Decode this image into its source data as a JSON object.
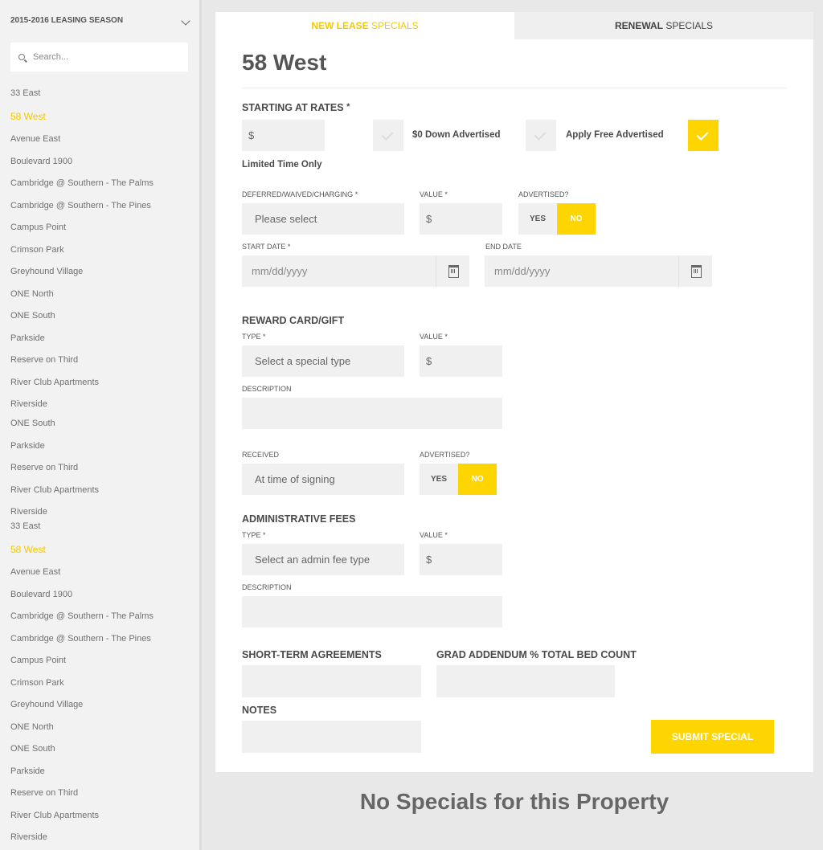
{
  "sidebar": {
    "season": "2015-2016 LEASING SEASON",
    "search_placeholder": "Search...",
    "properties": [
      "33 East",
      "58 West",
      "Avenue East",
      "Boulevard 1900",
      "Cambridge @ Southern - The Palms",
      "Cambridge @ Southern - The Pines",
      "Campus Point",
      "Crimson Park",
      "Greyhound Village",
      "ONE North",
      "ONE South",
      "Parkside",
      "Reserve on Third",
      "River Club Apartments",
      "Riverside",
      "ONE South",
      "Parkside",
      "Reserve on Third",
      "River Club Apartments",
      "Riverside",
      "33 East",
      "58 West",
      "Avenue East",
      "Boulevard 1900",
      "Cambridge @ Southern - The Palms",
      "Cambridge @ Southern - The Pines",
      "Campus Point",
      "Crimson Park",
      "Greyhound Village",
      "ONE North",
      "ONE South",
      "Parkside",
      "Reserve on Third",
      "River Club Apartments",
      "Riverside"
    ],
    "selected": "58 West"
  },
  "tabs": {
    "new_bold": "NEW LEASE",
    "new_rest": " SPECIALS",
    "renew_bold": "RENEWAL",
    "renew_rest": " SPECIALS"
  },
  "form": {
    "title": "58 West",
    "starting": {
      "heading": "STARTING AT RATES",
      "star": "*",
      "rate_value": "$",
      "zero_down_label": "$0 Down Advertised",
      "zero_down_checked": false,
      "apply_free_label": "Apply Free Advertised",
      "apply_free_checked": false,
      "limited_checked": true,
      "limited_label": "Limited Time Only"
    },
    "deferred": {
      "label": "DEFERRED/WAIVED/CHARGING",
      "value": "Please select",
      "value_label": "VALUE",
      "amount": "$",
      "advertised_label": "ADVERTISED?",
      "yes": "YES",
      "no": "NO",
      "selected": "NO"
    },
    "dates": {
      "start_label": "START DATE",
      "start_placeholder": "mm/dd/yyyy",
      "end_label": "END DATE",
      "end_placeholder": "mm/dd/yyyy"
    },
    "reward": {
      "heading": "REWARD CARD/GIFT",
      "type_label": "TYPE",
      "type_value": "Select a special type",
      "value_label": "VALUE",
      "amount": "$",
      "description_label": "DESCRIPTION",
      "description": "",
      "received_label": "RECEIVED",
      "received_value": "At time of signing",
      "advertised_label": "ADVERTISED?",
      "yes": "YES",
      "no": "NO",
      "selected": "NO"
    },
    "admin": {
      "heading": "ADMINISTRATIVE FEES",
      "type_label": "TYPE",
      "type_value": "Select an admin fee type",
      "value_label": "VALUE",
      "amount": "$",
      "description_label": "DESCRIPTION",
      "description": ""
    },
    "short_term_label": "SHORT-TERM AGREEMENTS",
    "grad_label": "GRAD ADDENDUM % TOTAL BED COUNT",
    "notes_label": "NOTES",
    "required_star": "*",
    "submit": "SUBMIT SPECIAL"
  },
  "empty_message": "No Specials for this Property",
  "colors": {
    "accent": "#ffd500",
    "field": "#f0f0f0",
    "text": "#555555"
  }
}
